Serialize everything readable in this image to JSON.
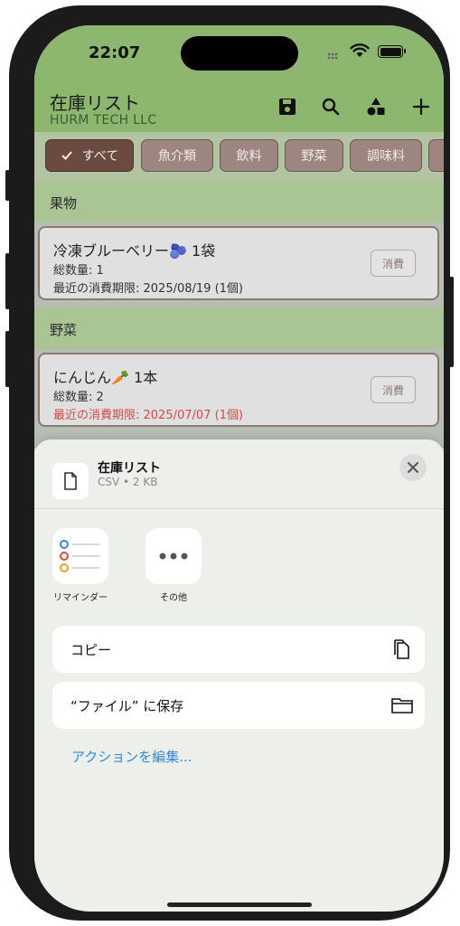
{
  "status_bar": {
    "time": "22:07"
  },
  "header": {
    "title": "在庫リスト",
    "subtitle": "HURM TECH LLC"
  },
  "header_icons": [
    "save-icon",
    "search-icon",
    "shapes-icon",
    "plus-icon"
  ],
  "filter_chips": [
    {
      "label": "すべて",
      "active": true
    },
    {
      "label": "魚介類",
      "active": false
    },
    {
      "label": "飲料",
      "active": false
    },
    {
      "label": "野菜",
      "active": false
    },
    {
      "label": "調味料",
      "active": false
    }
  ],
  "sections": [
    {
      "title": "果物",
      "items": [
        {
          "name": "冷凍ブルーベリー🫐 1袋",
          "quantity": "総数量: 1",
          "expiry": "最近の消費期限: 2025/08/19 (1個)",
          "expired": false,
          "action": "消費"
        }
      ]
    },
    {
      "title": "野菜",
      "items": [
        {
          "name": "にんじん🥕 1本",
          "quantity": "総数量: 2",
          "expiry": "最近の消費期限: 2025/07/07 (1個)",
          "expired": true,
          "action": "消費"
        }
      ]
    }
  ],
  "share_sheet": {
    "file_name": "在庫リスト",
    "file_meta": "CSV • 2 KB",
    "apps": [
      {
        "label": "リマインダー",
        "icon": "reminders-icon"
      },
      {
        "label": "その他",
        "icon": "more-icon"
      }
    ],
    "actions": [
      {
        "label": "コピー",
        "icon": "copy-icon"
      },
      {
        "label": "“ファイル” に保存",
        "icon": "folder-icon"
      }
    ],
    "edit_actions": "アクションを編集..."
  },
  "colors": {
    "header_green": "#8db66f",
    "section_green": "#a9c593",
    "chip_active": "#6b4a40",
    "chip_inactive": "#9d8580",
    "expired_red": "#d44a44",
    "link_blue": "#2f8ae0"
  }
}
